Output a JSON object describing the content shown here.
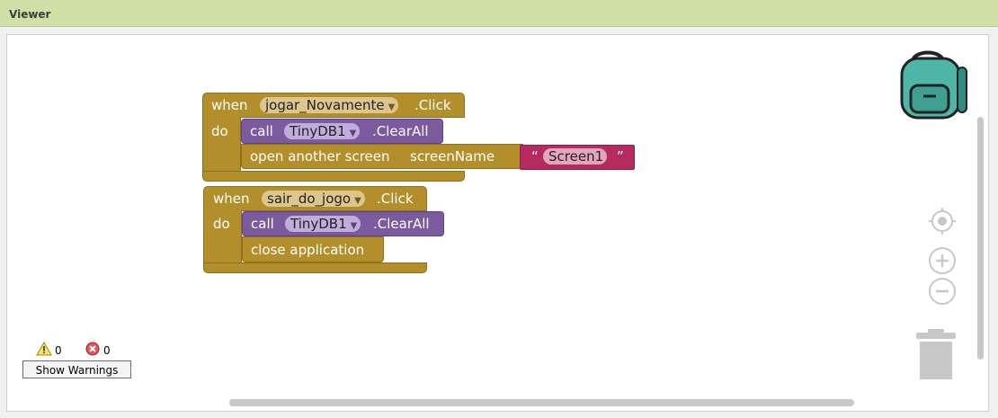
{
  "viewer": {
    "title": "Viewer"
  },
  "block1": {
    "when": "when",
    "component": "jogar_Novamente",
    "event": ".Click",
    "do": "do",
    "call1": {
      "call": "call",
      "component": "TinyDB1",
      "method": ".ClearAll"
    },
    "open": {
      "label": "open another screen",
      "param": "screenName"
    },
    "string": {
      "open_quote": "“",
      "value": "Screen1",
      "close_quote": "”"
    }
  },
  "block2": {
    "when": "when",
    "component": "sair_do_jogo",
    "event": ".Click",
    "do": "do",
    "call1": {
      "call": "call",
      "component": "TinyDB1",
      "method": ".ClearAll"
    },
    "close": {
      "label": "close application"
    }
  },
  "warnings": {
    "warning_count": "0",
    "error_count": "0",
    "show_button": "Show Warnings"
  },
  "icons": [
    "backpack-icon",
    "center-target-icon",
    "zoom-in-icon",
    "zoom-out-icon",
    "trash-icon",
    "warning-icon",
    "error-icon",
    "dropdown-arrow-icon"
  ],
  "colors": {
    "event_block": "#b38f2b",
    "component_block": "#7c5aa0",
    "text_block": "#b52b5f",
    "titlebar": "#cfdfa6"
  }
}
